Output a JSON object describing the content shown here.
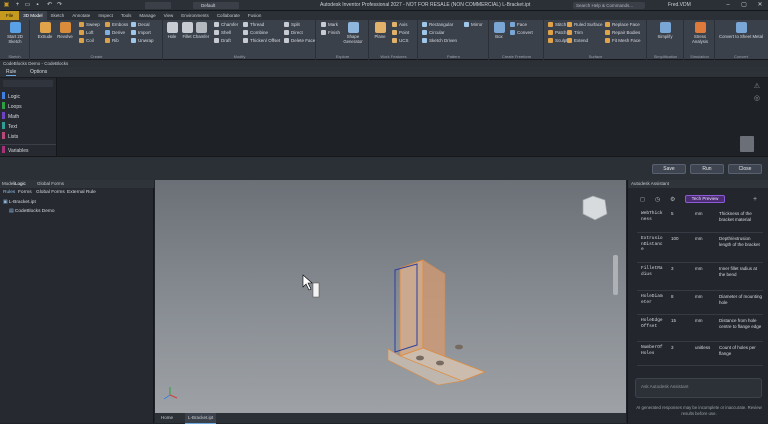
{
  "app": {
    "title": "Autodesk Inventor Professional 2027 - NOT FOR RESALE (NON COMMERCIAL)   L-Bracket.ipt",
    "search_placeholder": "Search Help & Commands...",
    "user": "Fred.VDM",
    "appearance": "Default"
  },
  "menu_tabs": [
    "File",
    "3D Model",
    "Sketch",
    "Annotate",
    "Inspect",
    "Tools",
    "Manage",
    "View",
    "Environments",
    "Collaborate",
    "Fusion"
  ],
  "ribbon": {
    "sketch": {
      "label": "Sketch",
      "start": "Start 2D Sketch"
    },
    "create": {
      "label": "Create",
      "extrude": "Extrude",
      "revolve": "Revolve",
      "small": [
        "Sweep",
        "Loft",
        "Coil",
        "Emboss",
        "Derive",
        "Rib",
        "Decal",
        "Import",
        "Unwrap"
      ]
    },
    "modify": {
      "label": "Modify",
      "big": [
        "Hole",
        "Fillet",
        "Chamfer"
      ],
      "small": [
        "Chamfer",
        "Shell",
        "Draft",
        "Thread",
        "Combine",
        "Thicken/ Offset",
        "Split",
        "Direct",
        "Delete Face"
      ]
    },
    "explore": {
      "label": "Explore",
      "shape": "Shape Generator",
      "mark": "Mark",
      "finish": "Finish"
    },
    "work": {
      "label": "Work Features",
      "plane": "Plane",
      "small": [
        "Axis",
        "Point",
        "UCS"
      ]
    },
    "pattern": {
      "label": "Pattern",
      "small": [
        "Rectangular",
        "Circular",
        "Sketch Driven",
        "Mirror"
      ]
    },
    "freeform": {
      "label": "Create Freeform",
      "box": "Box",
      "small": [
        "Face",
        "Convert"
      ]
    },
    "surface": {
      "label": "Surface",
      "small": [
        "Stitch",
        "Patch",
        "Sculpt",
        "Ruled Surface",
        "Trim",
        "Extend",
        "Replace Face",
        "Repair Bodies",
        "Fit Mesh Face"
      ]
    },
    "simplification": {
      "label": "Simplification",
      "simplify": "Simplify"
    },
    "simulation": {
      "label": "Simulation",
      "stress": "Stress Analysis"
    },
    "convert": {
      "label": "Convert",
      "sheet": "Convert to Sheet Metal"
    }
  },
  "doc_tab": "CodeBlocks Demo - CodeBlocks",
  "rule_tabs": [
    "Rule",
    "Options"
  ],
  "left_panel": [
    {
      "label": "Logic",
      "color": "#3d7ee0"
    },
    {
      "label": "Loops",
      "color": "#2ea043"
    },
    {
      "label": "Math",
      "color": "#6f42c1"
    },
    {
      "label": "Text",
      "color": "#2f9c95"
    },
    {
      "label": "Lists",
      "color": "#b8487a"
    },
    {
      "label": "Variables",
      "color": "#a83279"
    }
  ],
  "buttons": {
    "save": "Save",
    "run": "Run",
    "close": "Close"
  },
  "browser": {
    "tabs": [
      "Model",
      "iLogic"
    ],
    "tab3": "Global Forms",
    "subtabs": [
      "Rules",
      "Forms",
      "Global Forms",
      "External Rule"
    ],
    "items": [
      "L-Bracket.ipt",
      "CodeBlocks Demo"
    ]
  },
  "viewport": {
    "tabs": [
      "Home",
      "L-Bracket.ipt"
    ]
  },
  "assistant": {
    "title": "Autodesk Assistant",
    "tech_preview": "Tech Preview",
    "params": [
      {
        "name": "WebThickness",
        "value": "5",
        "unit": "mm",
        "desc": "Thickness of the bracket material"
      },
      {
        "name": "ExtrusionDistance",
        "value": "100",
        "unit": "mm",
        "desc": "Depth/extrusion length of the bracket"
      },
      {
        "name": "FilletRadius",
        "value": "3",
        "unit": "mm",
        "desc": "Inner fillet radius at the bend"
      },
      {
        "name": "HoleDiameter",
        "value": "8",
        "unit": "mm",
        "desc": "Diameter of mounting hole"
      },
      {
        "name": "HoleEdgeOffset",
        "value": "15",
        "unit": "mm",
        "desc": "Distance from hole centre to flange edge"
      },
      {
        "name": "NumberOfHoles",
        "value": "3",
        "unit": "unitless",
        "desc": "Count of holes per flange"
      }
    ],
    "ask_placeholder": "Ask Autodesk Assistant",
    "disclaimer": "AI generated responses may be incomplete or inaccurate. Review results before use."
  },
  "colors": {
    "accent": "#c69a1f",
    "ribbon": "#3b414b",
    "tech": "#8c5ad6"
  }
}
